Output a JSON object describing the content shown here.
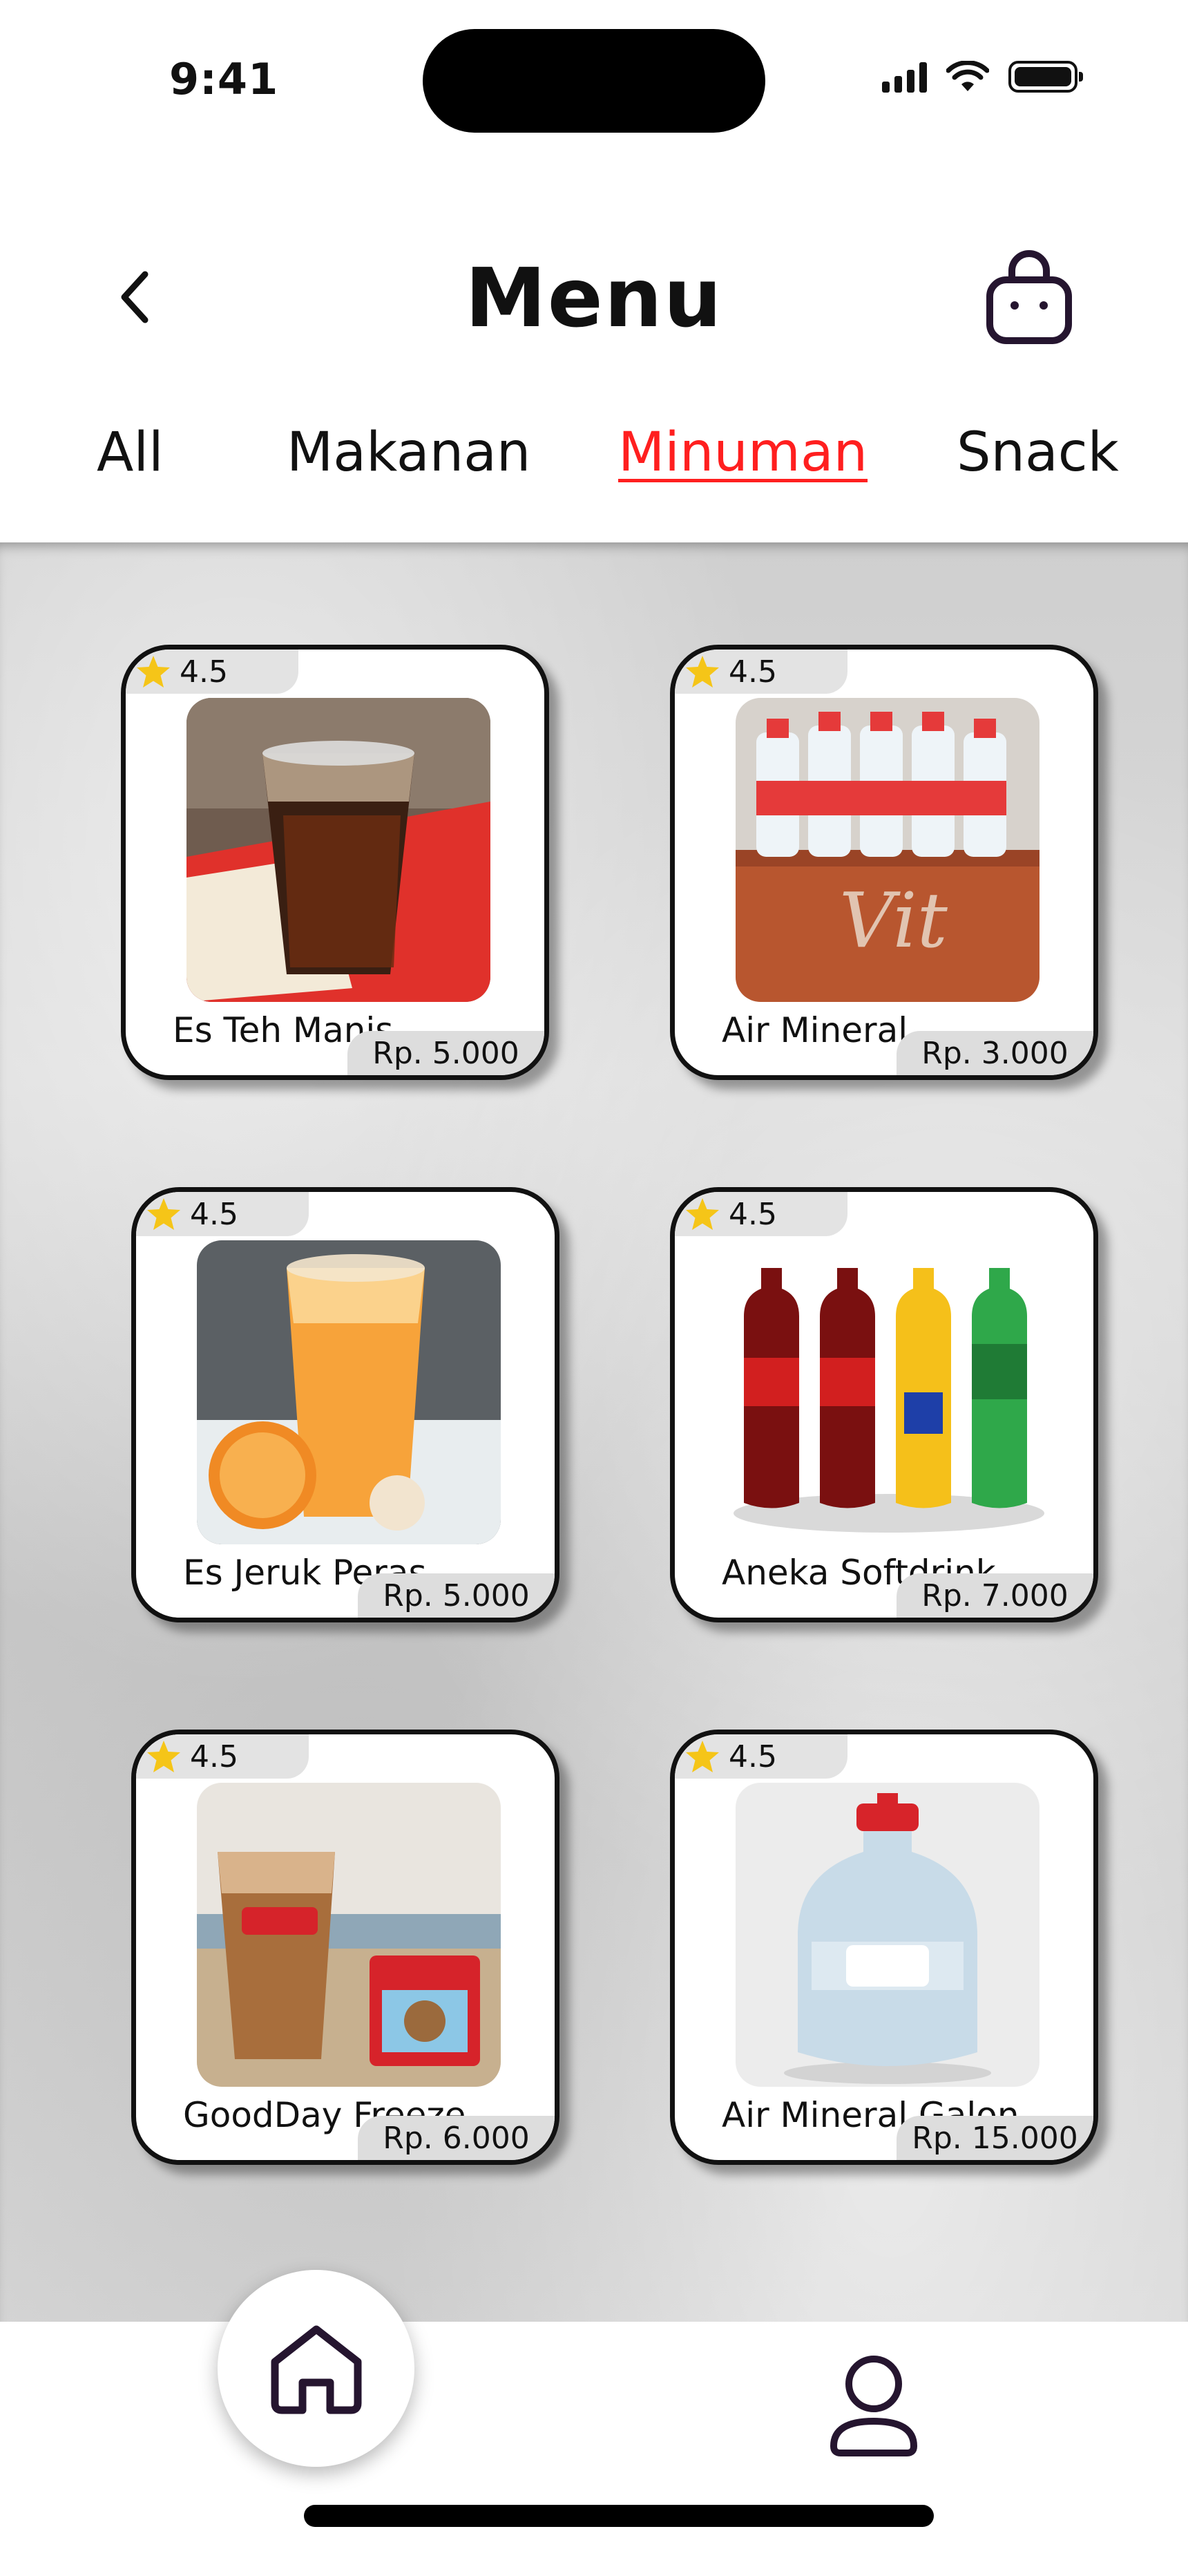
{
  "status_bar": {
    "time": "9:41"
  },
  "header": {
    "title": "Menu",
    "back_icon": "chevron-left-icon",
    "cart_icon": "shopping-bag-icon"
  },
  "tabs": [
    {
      "label": "All",
      "active": false
    },
    {
      "label": "Makanan",
      "active": false
    },
    {
      "label": "Minuman",
      "active": true
    },
    {
      "label": "Snack",
      "active": false
    }
  ],
  "colors": {
    "active_tab": "#ff1f1f",
    "star": "#f5c518",
    "icon_dark": "#25152f"
  },
  "products": [
    {
      "rating": "4.5",
      "name": "Es Teh Manis",
      "price": "Rp. 5.000"
    },
    {
      "rating": "4.5",
      "name": "Air Mineral",
      "price": "Rp. 3.000"
    },
    {
      "rating": "4.5",
      "name": "Es Jeruk Peras",
      "price": "Rp. 5.000"
    },
    {
      "rating": "4.5",
      "name": "Aneka Softdrink",
      "price": "Rp. 7.000"
    },
    {
      "rating": "4.5",
      "name": "GoodDay Freeze",
      "price": "Rp. 6.000"
    },
    {
      "rating": "4.5",
      "name": "Air Mineral Galon",
      "price": "Rp. 15.000"
    }
  ],
  "bottom_nav": {
    "home_icon": "home-icon",
    "profile_icon": "user-icon"
  }
}
